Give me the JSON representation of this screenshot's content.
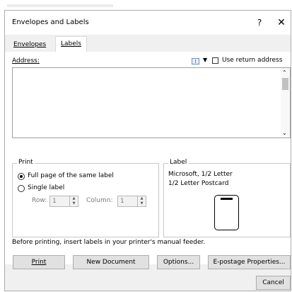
{
  "window": {
    "title": "Envelopes and Labels",
    "help": "?",
    "close": "✕"
  },
  "tabs": [
    {
      "label": "Envelopes",
      "active": false
    },
    {
      "label": "Labels",
      "active": true
    }
  ],
  "address": {
    "label": "Address:",
    "value": "",
    "use_return_address": "Use return address",
    "use_return_checked": false
  },
  "print": {
    "title": "Print",
    "full_page": "Full page of the same label",
    "single_label": "Single label",
    "selected": "full_page",
    "row_label": "Row:",
    "row_value": "1",
    "column_label": "Column:",
    "column_value": "1"
  },
  "label": {
    "title": "Label",
    "line1": "Microsoft, 1/2 Letter",
    "line2": "1/2 Letter Postcard"
  },
  "note": "Before printing, insert labels in your printer's manual feeder.",
  "buttons": {
    "print": "Print",
    "new_document": "New Document",
    "options": "Options...",
    "epostage": "E-postage Properties...",
    "cancel": "Cancel"
  },
  "icons": {
    "address_book": "address-book-icon",
    "dropdown": "chevron-down-icon"
  }
}
